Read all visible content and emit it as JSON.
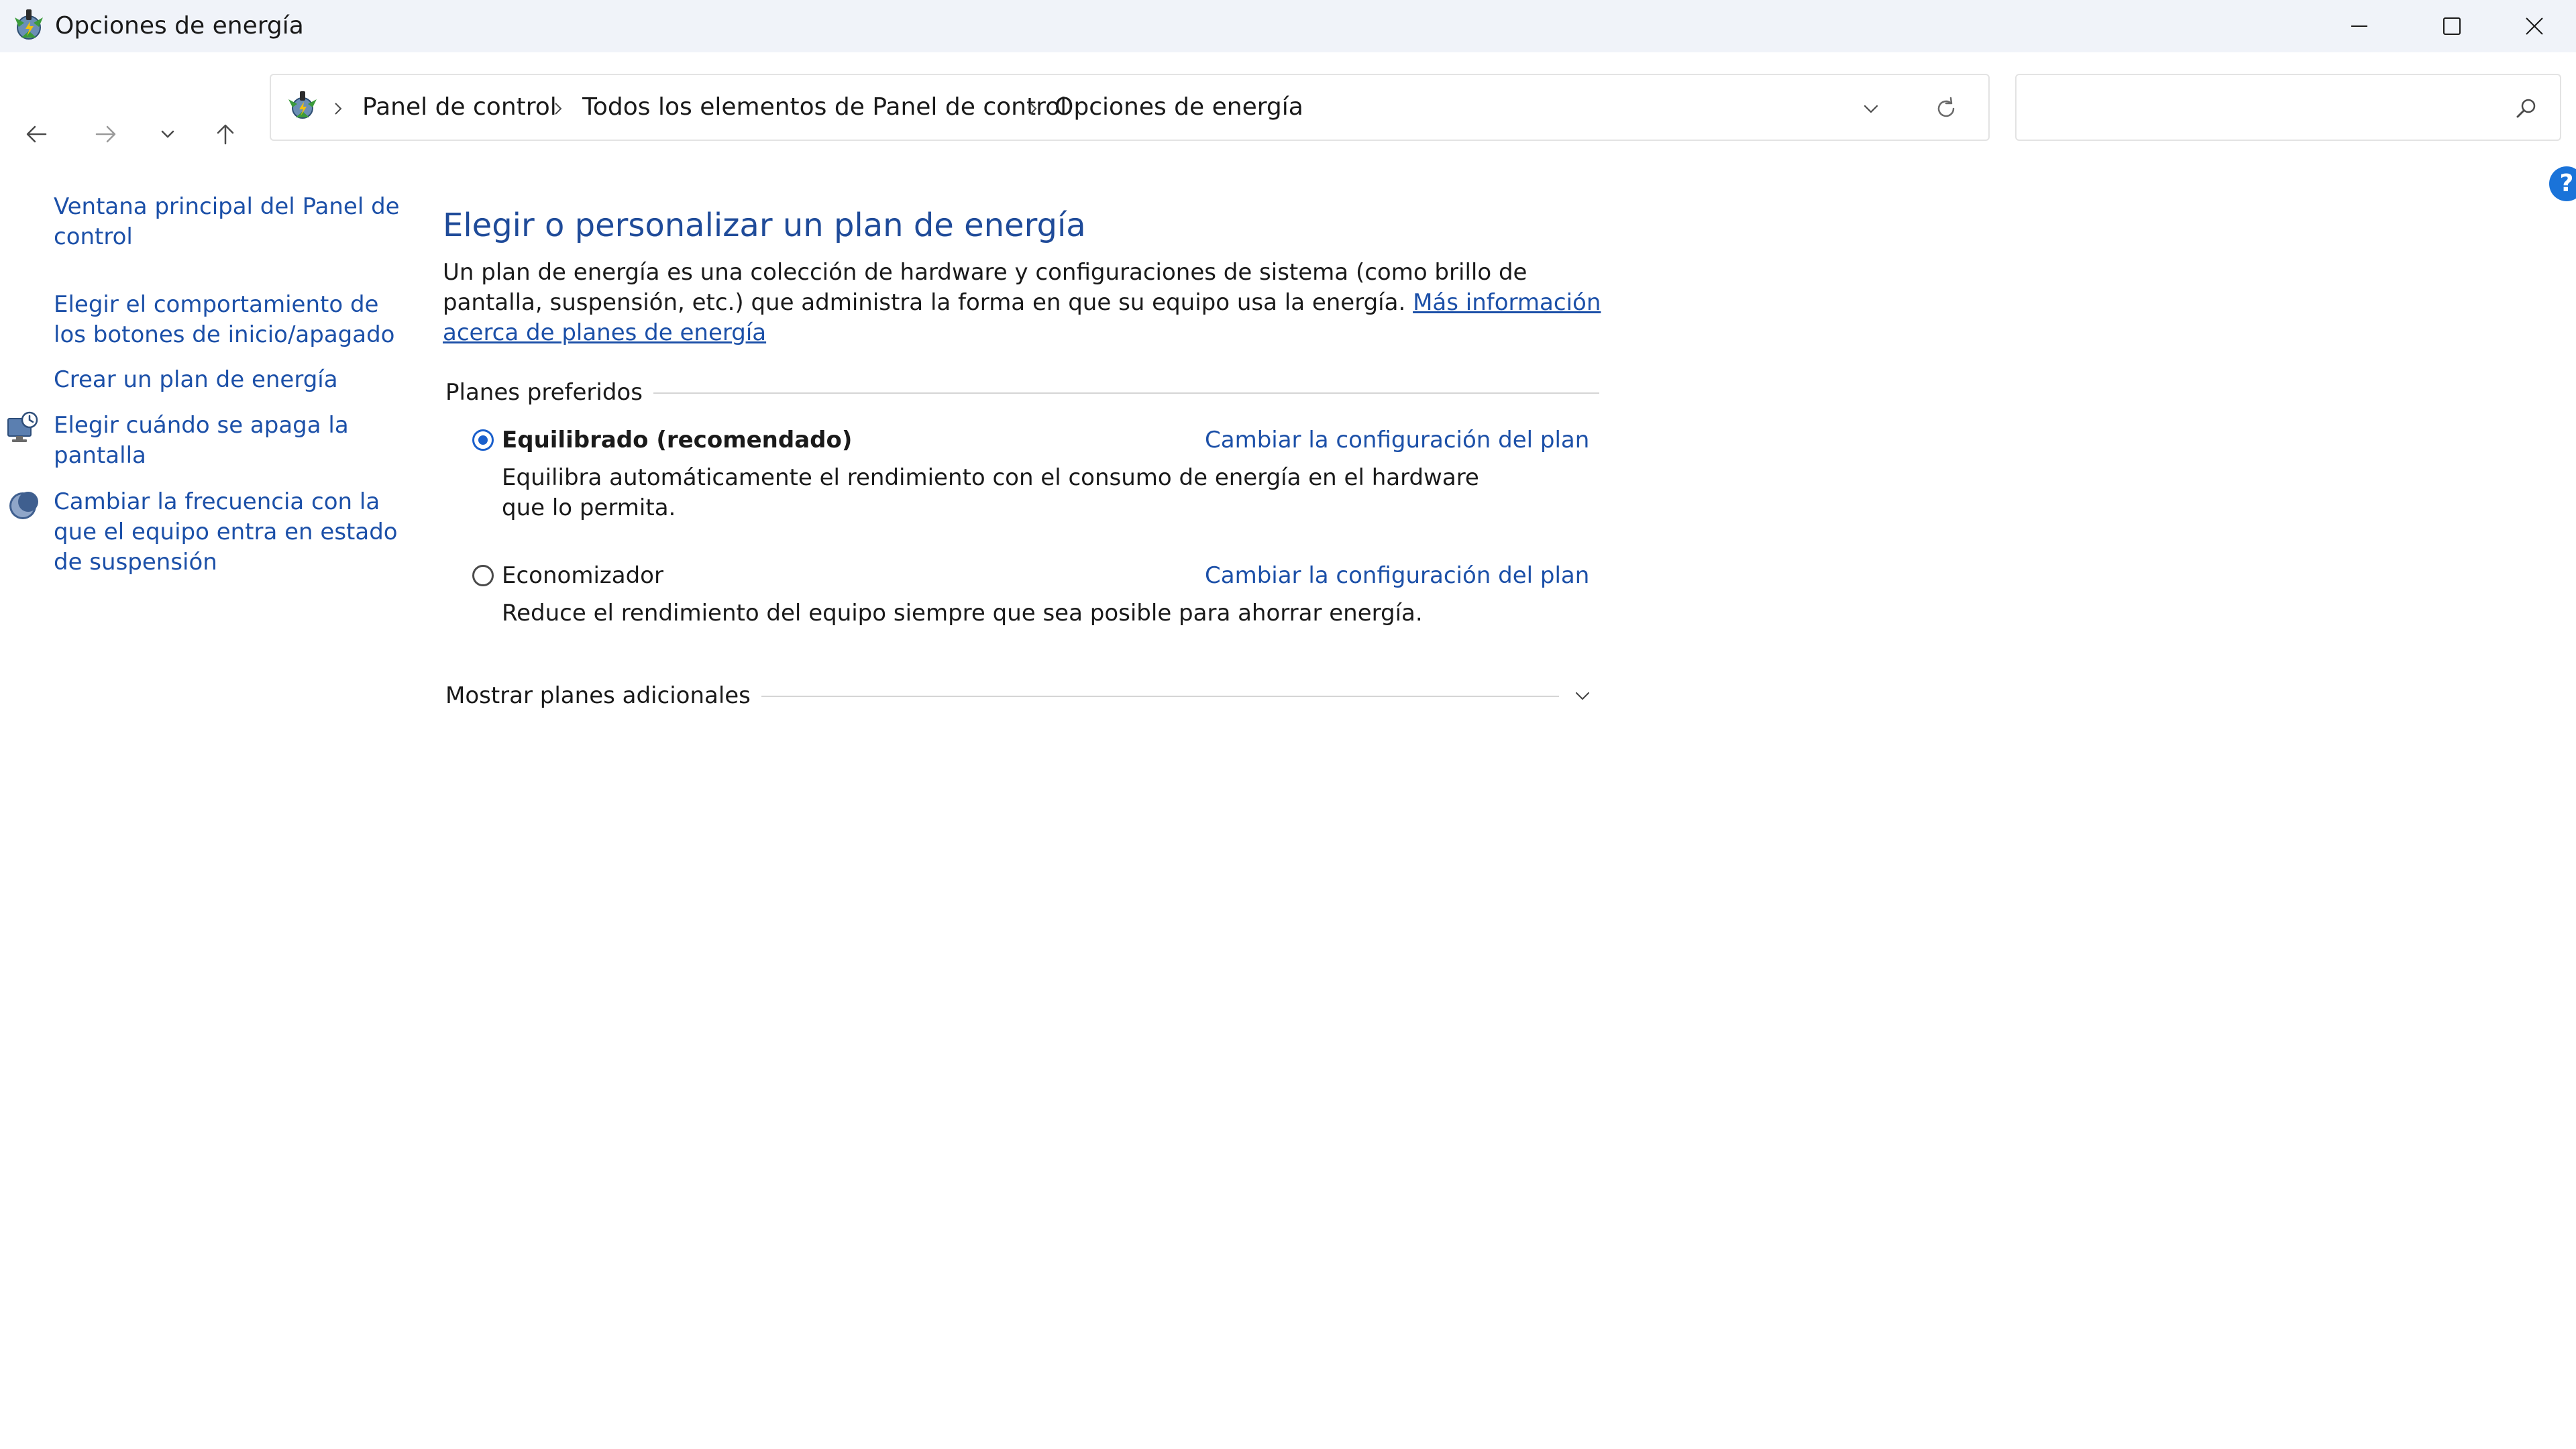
{
  "window": {
    "title": "Opciones de energía"
  },
  "navigation": {
    "breadcrumbs": [
      "Panel de control",
      "Todos los elementos de Panel de control",
      "Opciones de energía"
    ],
    "search": {
      "placeholder": "",
      "value": ""
    }
  },
  "sidebar": {
    "links": [
      "Ventana principal del Panel de control",
      "Elegir el comportamiento de los botones de inicio/apagado",
      "Crear un plan de energía",
      "Elegir cuándo se apaga la pantalla",
      "Cambiar la frecuencia con la que el equipo entra en estado de suspensión"
    ]
  },
  "main": {
    "title": "Elegir o personalizar un plan de energía",
    "intro_text": "Un plan de energía es una colección de hardware y configuraciones de sistema (como brillo de pantalla, suspensión, etc.) que administra la forma en que su equipo usa la energía.",
    "intro_link": "Más información acerca de planes de energía",
    "preferred_plans_label": "Planes preferidos",
    "plans": [
      {
        "name": "Equilibrado (recomendado)",
        "selected": true,
        "settings_link": "Cambiar la configuración del plan",
        "description": "Equilibra automáticamente el rendimiento con el consumo de energía en el hardware que lo permita."
      },
      {
        "name": "Economizador",
        "selected": false,
        "settings_link": "Cambiar la configuración del plan",
        "description": "Reduce el rendimiento del equipo siempre que sea posible para ahorrar energía."
      }
    ],
    "additional_plans_label": "Mostrar planes adicionales"
  },
  "icons": {
    "app": "power-options-icon",
    "help": "help-icon",
    "help_glyph": "?"
  },
  "colors": {
    "link": "#1c50a8",
    "title": "#1f4b99",
    "accent": "#1a5fcc",
    "titlebar": "#f0f3f9"
  }
}
